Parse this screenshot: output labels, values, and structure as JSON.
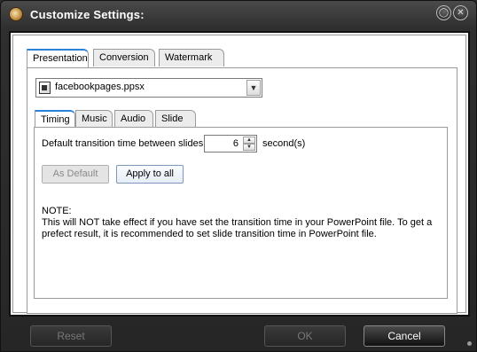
{
  "window": {
    "title": "Customize Settings:",
    "minimize_glyph": "◯",
    "close_glyph": "✕",
    "icon": "app-disc-icon"
  },
  "outer_tabs": [
    {
      "label": "Presentation",
      "active": true
    },
    {
      "label": "Conversion",
      "active": false
    },
    {
      "label": "Watermark",
      "active": false
    }
  ],
  "file_select": {
    "value": "facebookpages.ppsx",
    "icon": "presentation-file-icon",
    "arrow": "▼"
  },
  "inner_tabs": [
    {
      "label": "Timing",
      "active": true
    },
    {
      "label": "Music",
      "active": false
    },
    {
      "label": "Audio",
      "active": false
    },
    {
      "label": "Slide",
      "active": false
    }
  ],
  "timing": {
    "label": "Default transition time between slides:",
    "value": "6",
    "unit": "second(s)",
    "as_default_label": "As Default",
    "apply_label": "Apply to all",
    "note_title": "NOTE:",
    "note_body": "This will NOT take effect if you have set the transition time in your PowerPoint file. To get a prefect result, it is recommended to set slide transition time in PowerPoint file."
  },
  "footer": {
    "reset": "Reset",
    "ok": "OK",
    "cancel": "Cancel"
  }
}
